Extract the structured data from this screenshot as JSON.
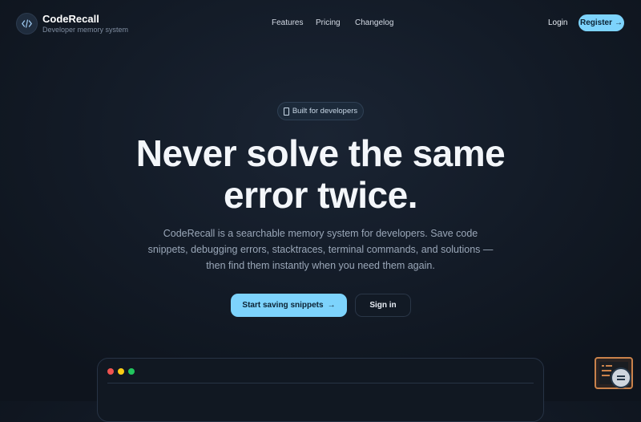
{
  "brand": {
    "name": "CodeRecall",
    "tagline": "Developer memory system",
    "logo_icon": "code-icon"
  },
  "nav": {
    "links": [
      "Features",
      "Pricing",
      "Changelog"
    ],
    "login_label": "Login",
    "register_label": "Register",
    "register_arrow": "→"
  },
  "hero": {
    "badge_icon": "code-file-icon",
    "badge_label": "Built for developers",
    "title_line1": "Never solve the same",
    "title_line2": "error twice.",
    "description": "CodeRecall is a searchable memory system for developers. Save code snippets, debugging errors, stacktraces, terminal commands, and solutions — then find them instantly when you need them again.",
    "primary_cta": "Start saving snippets",
    "primary_cta_arrow": "→",
    "secondary_cta": "Sign in"
  },
  "terminal": {
    "dots": [
      "#ef5350",
      "#facc15",
      "#22c55e"
    ]
  },
  "colors": {
    "accent": "#7dd3fc",
    "background": "#131b27"
  }
}
